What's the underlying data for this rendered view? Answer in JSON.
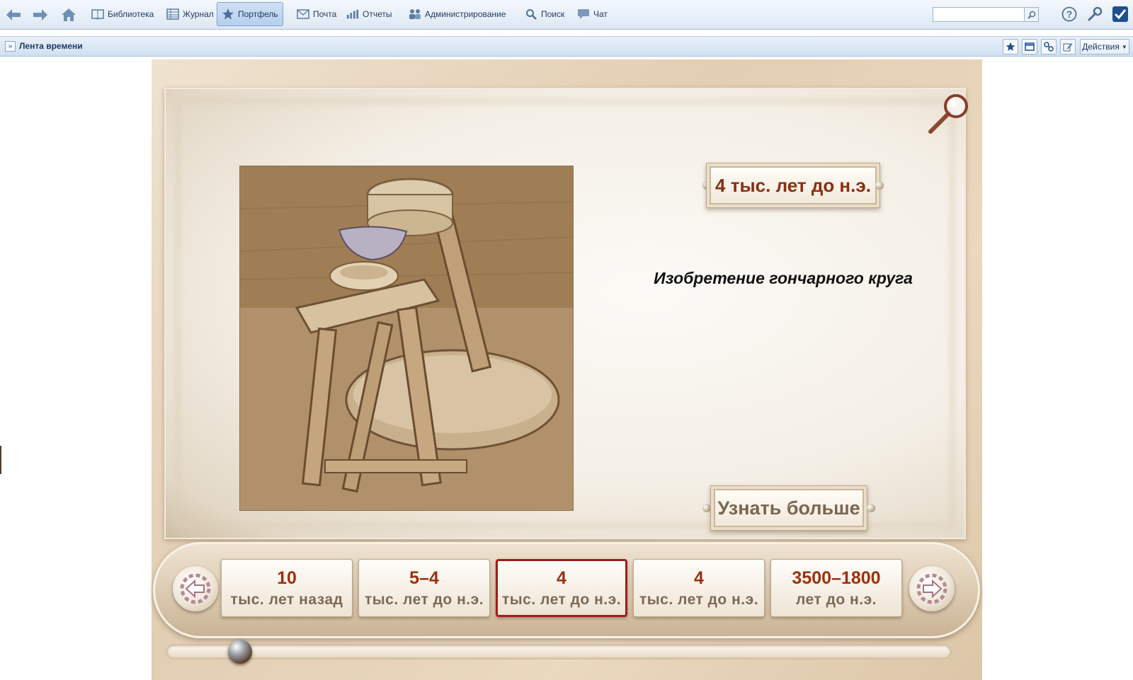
{
  "toolbar": {
    "items": [
      {
        "label": "Библиотека",
        "icon": "book-icon"
      },
      {
        "label": "Журнал",
        "icon": "journal-icon"
      },
      {
        "label": "Портфель",
        "icon": "star-icon",
        "active": true
      },
      {
        "label": "Почта",
        "icon": "mail-icon"
      },
      {
        "label": "Отчеты",
        "icon": "chart-icon"
      },
      {
        "label": "Администрирование",
        "icon": "admin-icon"
      },
      {
        "label": "Поиск",
        "icon": "search-icon"
      },
      {
        "label": "Чат",
        "icon": "chat-icon"
      }
    ],
    "search_value": ""
  },
  "crumbbar": {
    "title": "Лента времени",
    "actions_label": "Действия"
  },
  "event": {
    "date_label": "4 тыс. лет до н.э.",
    "title": "Изобретение гончарного круга",
    "more_label": "Узнать больше"
  },
  "timeline": {
    "cards": [
      {
        "big": "10",
        "small": "тыс. лет назад"
      },
      {
        "big": "5–4",
        "small": "тыс. лет до н.э."
      },
      {
        "big": "4",
        "small": "тыс. лет до н.э.",
        "selected": true
      },
      {
        "big": "4",
        "small": "тыс. лет до н.э."
      },
      {
        "big": "3500–1800",
        "small": "лет до н.э."
      }
    ],
    "scroll_position_fraction": 0.08
  },
  "colors": {
    "accent_red": "#a01c1c",
    "date_text": "#8a2e12",
    "toolbar_text": "#1f3a5f"
  }
}
